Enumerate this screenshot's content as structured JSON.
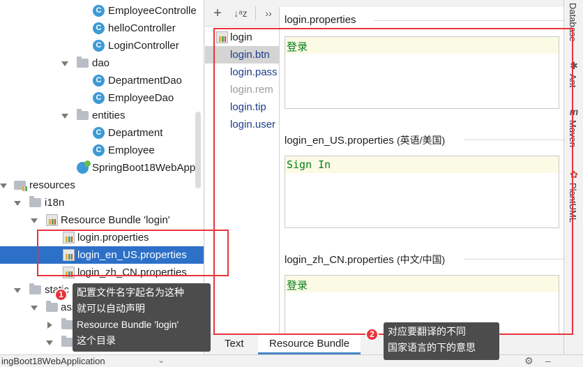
{
  "tree": {
    "items": [
      {
        "label": "EmployeeControlle",
        "icon": "class-icon"
      },
      {
        "label": "helloController",
        "icon": "class-icon"
      },
      {
        "label": "LoginController",
        "icon": "class-icon"
      },
      {
        "label": "dao",
        "icon": "folder-icon"
      },
      {
        "label": "DepartmentDao",
        "icon": "class-icon"
      },
      {
        "label": "EmployeeDao",
        "icon": "class-icon"
      },
      {
        "label": "entities",
        "icon": "folder-icon"
      },
      {
        "label": "Department",
        "icon": "class-icon"
      },
      {
        "label": "Employee",
        "icon": "class-icon"
      },
      {
        "label": "SpringBoot18WebApp",
        "icon": "springboot-app-icon"
      },
      {
        "label": "resources",
        "icon": "resources-folder-icon"
      },
      {
        "label": "i18n",
        "icon": "folder-icon"
      },
      {
        "label": "Resource Bundle 'login'",
        "icon": "resource-bundle-icon"
      },
      {
        "label": "login.properties",
        "icon": "properties-file-icon"
      },
      {
        "label": "login_en_US.properties",
        "icon": "properties-file-icon"
      },
      {
        "label": "login_zh_CN.properties",
        "icon": "properties-file-icon"
      },
      {
        "label": "static",
        "icon": "folder-icon"
      },
      {
        "label": "asse",
        "icon": "folder-icon"
      },
      {
        "label": "",
        "icon": "folder-icon"
      },
      {
        "label": "g",
        "icon": "folder-icon"
      }
    ],
    "class_badge": "C",
    "bottom_text": "ingBoot18WebApplication"
  },
  "toolbar": {
    "add": "+",
    "sort": "↓ᵃz",
    "more": "››"
  },
  "keys": [
    {
      "label": "login"
    },
    {
      "label": "login.btn"
    },
    {
      "label": "login.pass"
    },
    {
      "label": "login.rem"
    },
    {
      "label": "login.tip"
    },
    {
      "label": "login.user"
    }
  ],
  "values": [
    {
      "file": "login.properties",
      "locale": "",
      "value": "登录"
    },
    {
      "file": "login_en_US.properties",
      "locale": "(英语/美国)",
      "value": "Sign In"
    },
    {
      "file": "login_zh_CN.properties",
      "locale": "(中文/中国)",
      "value": "登录"
    }
  ],
  "tabs": [
    {
      "label": "Text",
      "active": false
    },
    {
      "label": "Resource Bundle",
      "active": true
    }
  ],
  "right_strip": [
    {
      "label": "Database"
    },
    {
      "label": "Ant"
    },
    {
      "label": "Maven"
    },
    {
      "label": "PlantUML"
    }
  ],
  "annotations": [
    {
      "number": "1",
      "lines": [
        "配置文件名字起名为这种",
        "就可以自动声明",
        "Resource Bundle 'login'",
        "这个目录"
      ]
    },
    {
      "number": "2",
      "lines": [
        "对应要翻译的不同",
        "国家语言的下的意思"
      ]
    }
  ],
  "colors": {
    "accent": "#2c70c8",
    "annotation_red": "#e8333a",
    "value_green": "#067d17"
  }
}
